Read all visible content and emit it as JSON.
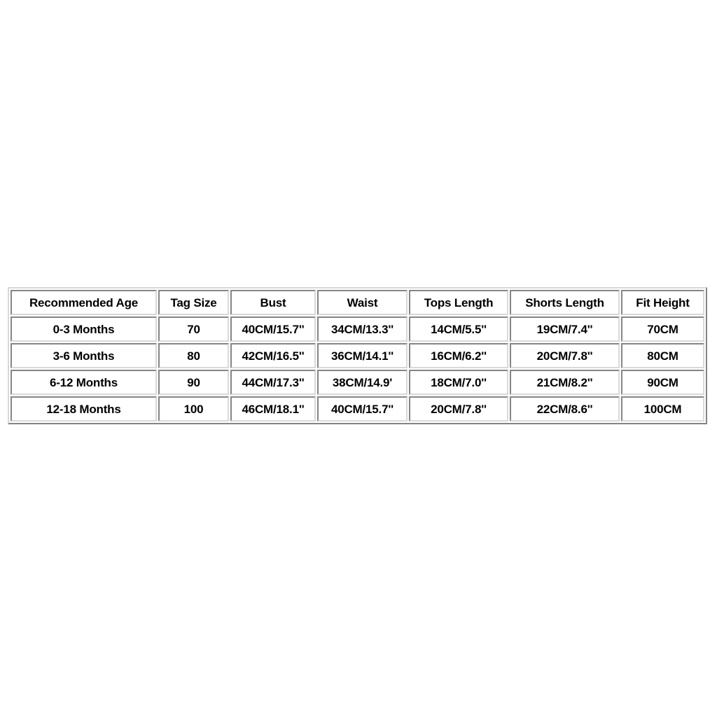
{
  "page": {
    "background_color": "#ffffff",
    "text_color": "#000000",
    "border_color": "#d9d9d9"
  },
  "size_chart": {
    "columns": [
      "Recommended Age",
      "Tag Size",
      "Bust",
      "Waist",
      "Tops Length",
      "Shorts Length",
      "Fit Height"
    ],
    "rows": [
      {
        "recommended_age": "0-3 Months",
        "tag_size": "70",
        "bust": "40CM/15.7''",
        "waist": "34CM/13.3''",
        "tops_length": "14CM/5.5''",
        "shorts_length": "19CM/7.4''",
        "fit_height": "70CM"
      },
      {
        "recommended_age": "3-6 Months",
        "tag_size": "80",
        "bust": "42CM/16.5''",
        "waist": "36CM/14.1''",
        "tops_length": "16CM/6.2''",
        "shorts_length": "20CM/7.8''",
        "fit_height": "80CM"
      },
      {
        "recommended_age": "6-12 Months",
        "tag_size": "90",
        "bust": "44CM/17.3''",
        "waist": "38CM/14.9'",
        "tops_length": "18CM/7.0''",
        "shorts_length": "21CM/8.2''",
        "fit_height": "90CM"
      },
      {
        "recommended_age": "12-18 Months",
        "tag_size": "100",
        "bust": "46CM/18.1''",
        "waist": "40CM/15.7''",
        "tops_length": "20CM/7.8''",
        "shorts_length": "22CM/8.6''",
        "fit_height": "100CM"
      }
    ]
  }
}
